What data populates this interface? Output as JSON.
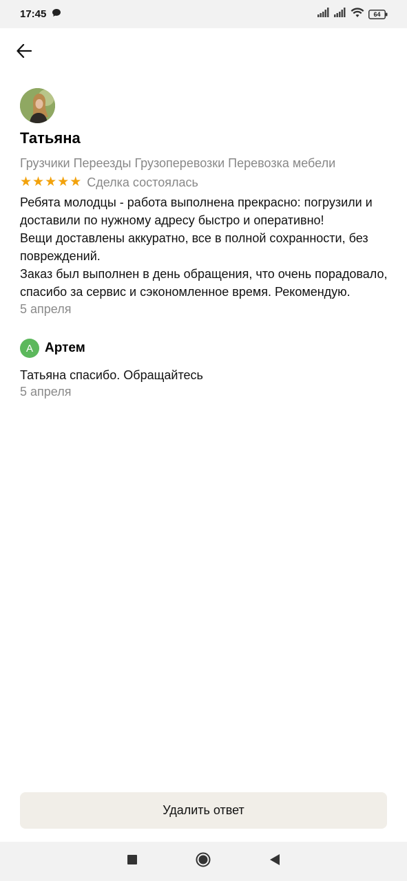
{
  "status": {
    "time": "17:45",
    "battery": "64",
    "icons": [
      "chat-bubble-icon",
      "signal-icon",
      "signal-icon",
      "wifi-icon",
      "battery-icon"
    ]
  },
  "header": {
    "back_icon": "arrow-left-icon"
  },
  "review": {
    "author": "Татьяна",
    "categories": "Грузчики Переезды Грузоперевозки Перевозка мебели",
    "stars": 5,
    "deal_status": "Сделка состоялась",
    "text": "Ребята молодцы - работа выполнена прекрасно: погрузили и доставили по нужному адресу быстро и оперативно!\nВещи доставлены аккуратно, все в полной сохранности, без повреждений.\nЗаказ был выполнен в день обращения, что очень порадовало, спасибо за сервис и  сэкономленное время. Рекомендую.",
    "date": "5 апреля"
  },
  "reply": {
    "avatar_letter": "А",
    "author": "Артем",
    "text": "Татьяна спасибо. Обращайтесь",
    "date": "5 апреля"
  },
  "actions": {
    "delete_reply_label": "Удалить ответ"
  },
  "colors": {
    "star": "#f2a20c",
    "reply_avatar": "#5cb85c",
    "button_bg": "#f1eee8"
  }
}
